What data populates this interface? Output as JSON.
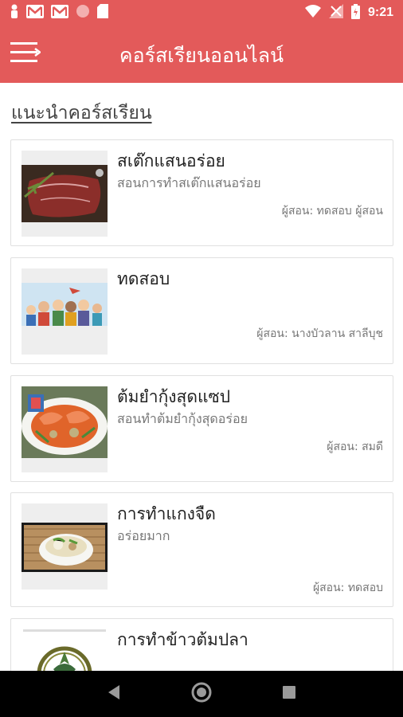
{
  "status_bar": {
    "time": "9:21",
    "icons": [
      "person-icon",
      "gmail-icon",
      "gmail-icon",
      "circle-icon",
      "sd-card-icon",
      "wifi-icon",
      "signal-icon",
      "battery-icon"
    ]
  },
  "app_bar": {
    "title": "คอร์สเรียนออนไลน์",
    "menu_icon": "menu-icon"
  },
  "section": {
    "title": "แนะนำคอร์สเรียน"
  },
  "courses": [
    {
      "title": "สเต๊กแสนอร่อย",
      "subtitle": "สอนการทำสเต๊กแสนอร่อย",
      "instructor": "ผู้สอน: ทดสอบ ผู้สอน",
      "image": "steak-image"
    },
    {
      "title": "ทดสอบ",
      "subtitle": "",
      "instructor": "ผู้สอน: นางบัวลาน   สาลีบุช",
      "image": "people-illustration-image"
    },
    {
      "title": "ต้มยำกุ้งสุดแซป",
      "subtitle": "สอนทำต้มยำกุ้งสุดอร่อย",
      "instructor": "ผู้สอน: สมดี",
      "image": "tom-yum-image"
    },
    {
      "title": "การทำแกงจืด",
      "subtitle": "อร่อยมาก",
      "instructor": "ผู้สอน: ทดสอบ",
      "image": "clear-soup-image"
    },
    {
      "title": "การทำข้าวต้มปลา",
      "subtitle": "",
      "instructor": "",
      "image": "emblem-image"
    }
  ],
  "nav_bar": {
    "icons": [
      "back-icon",
      "home-icon",
      "recents-icon"
    ]
  },
  "colors": {
    "primary": "#e35a5a",
    "nav": "#000000"
  }
}
